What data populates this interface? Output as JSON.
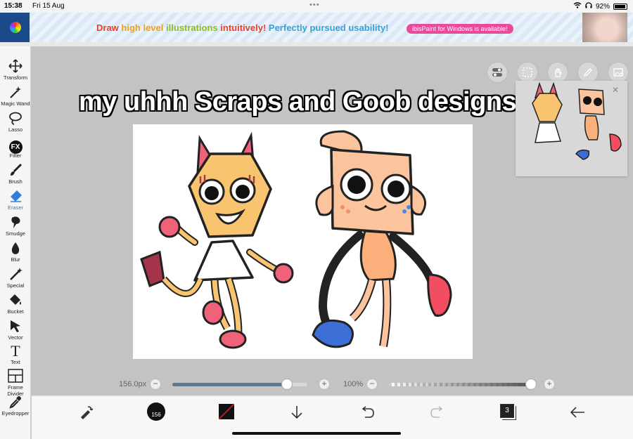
{
  "status_bar": {
    "time": "15:38",
    "date": "Fri 15 Aug",
    "battery": "92%"
  },
  "banner": {
    "logo": "iP",
    "headline_parts": [
      "Draw ",
      "high level ",
      "illustrations ",
      "intuitively! ",
      "Perfectly pursued usability!"
    ],
    "pill": "ibisPaint for Windows is available!"
  },
  "tools": [
    {
      "label": "Transform",
      "icon": "transform-icon"
    },
    {
      "label": "Magic Wand",
      "icon": "magic-wand-icon"
    },
    {
      "label": "Lasso",
      "icon": "lasso-icon"
    },
    {
      "label": "Filter",
      "icon": "filter-fx-icon",
      "glyph": "FX"
    },
    {
      "label": "Brush",
      "icon": "brush-icon"
    },
    {
      "label": "Eraser",
      "icon": "eraser-icon",
      "active": true
    },
    {
      "label": "Smudge",
      "icon": "smudge-icon"
    },
    {
      "label": "Blur",
      "icon": "blur-icon"
    },
    {
      "label": "Special",
      "icon": "special-icon"
    },
    {
      "label": "Bucket",
      "icon": "bucket-icon"
    },
    {
      "label": "Vector",
      "icon": "vector-icon"
    },
    {
      "label": "Text",
      "icon": "text-icon",
      "glyph": "T"
    },
    {
      "label": "Frame Divider",
      "icon": "frame-divider-icon"
    },
    {
      "label": "Eyedropper",
      "icon": "eyedropper-icon"
    }
  ],
  "canvas": {
    "caption": "my uhhh Scraps and Goob designs"
  },
  "brush": {
    "size_label": "156.0px",
    "size_fraction": 0.85,
    "opacity_label": "100%",
    "opacity_fraction": 1.0,
    "size_badge": "156"
  },
  "layers": {
    "count": "3"
  },
  "colors": {
    "accent": "#2e7fd6",
    "banner_pill": "#e84b9c"
  }
}
